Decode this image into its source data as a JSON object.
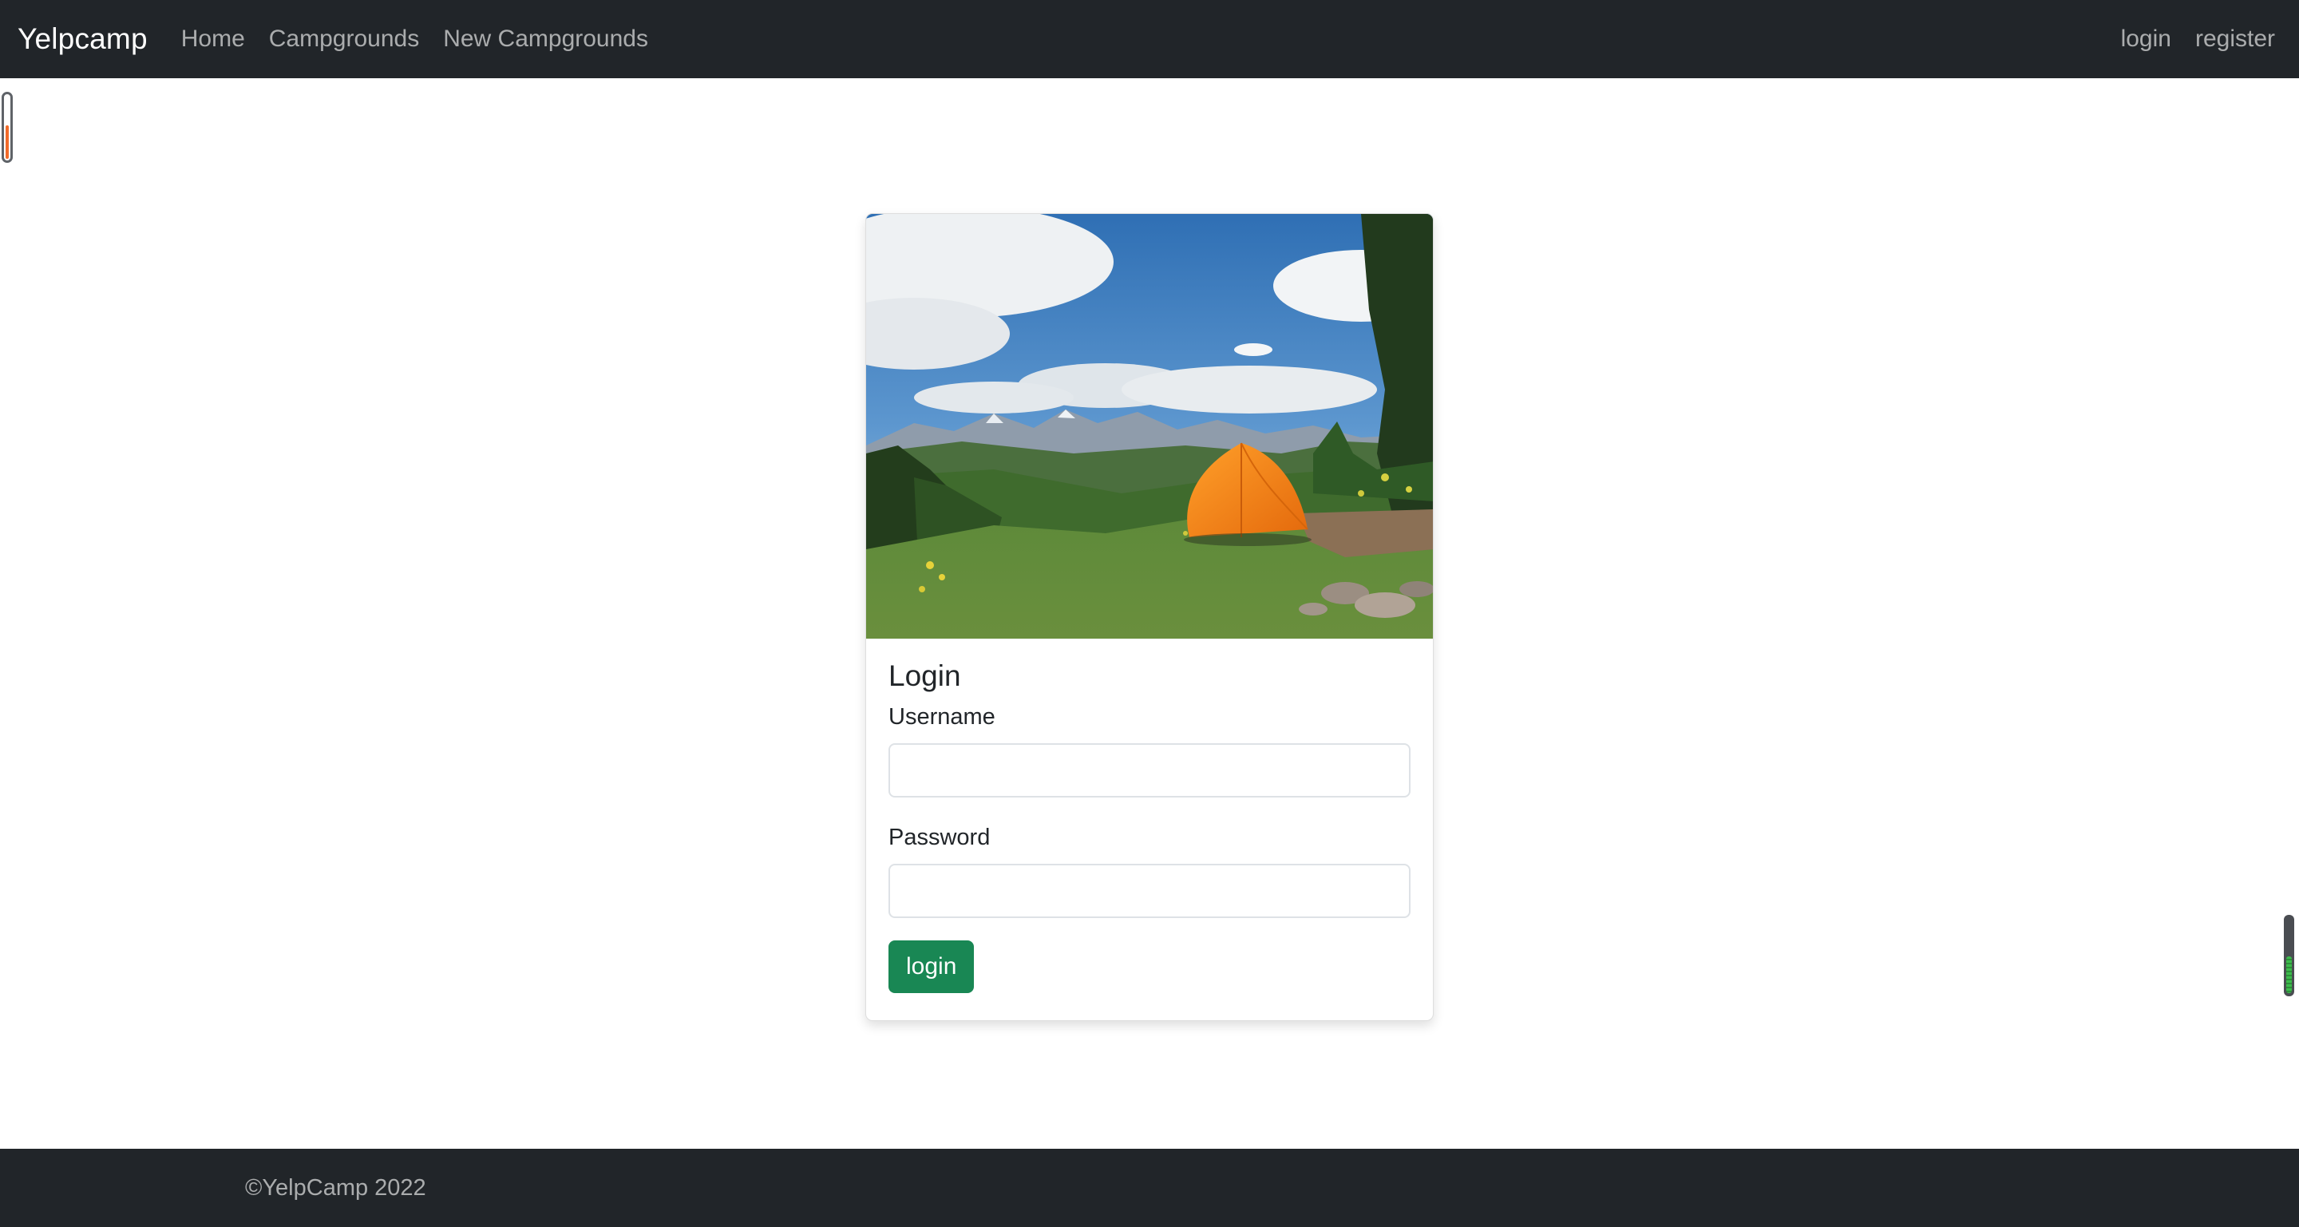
{
  "navbar": {
    "brand": "Yelpcamp",
    "links": [
      "Home",
      "Campgrounds",
      "New Campgrounds"
    ],
    "auth_links": [
      "login",
      "register"
    ],
    "background": "#212529"
  },
  "card": {
    "image": {
      "description": "orange tent on grassy hill",
      "icon": "campground-photo"
    },
    "title": "Login",
    "username_label": "Username",
    "username_value": "",
    "password_label": "Password",
    "password_value": "",
    "submit_label": "login",
    "submit_color": "#198754"
  },
  "footer": {
    "text": "©YelpCamp 2022"
  }
}
